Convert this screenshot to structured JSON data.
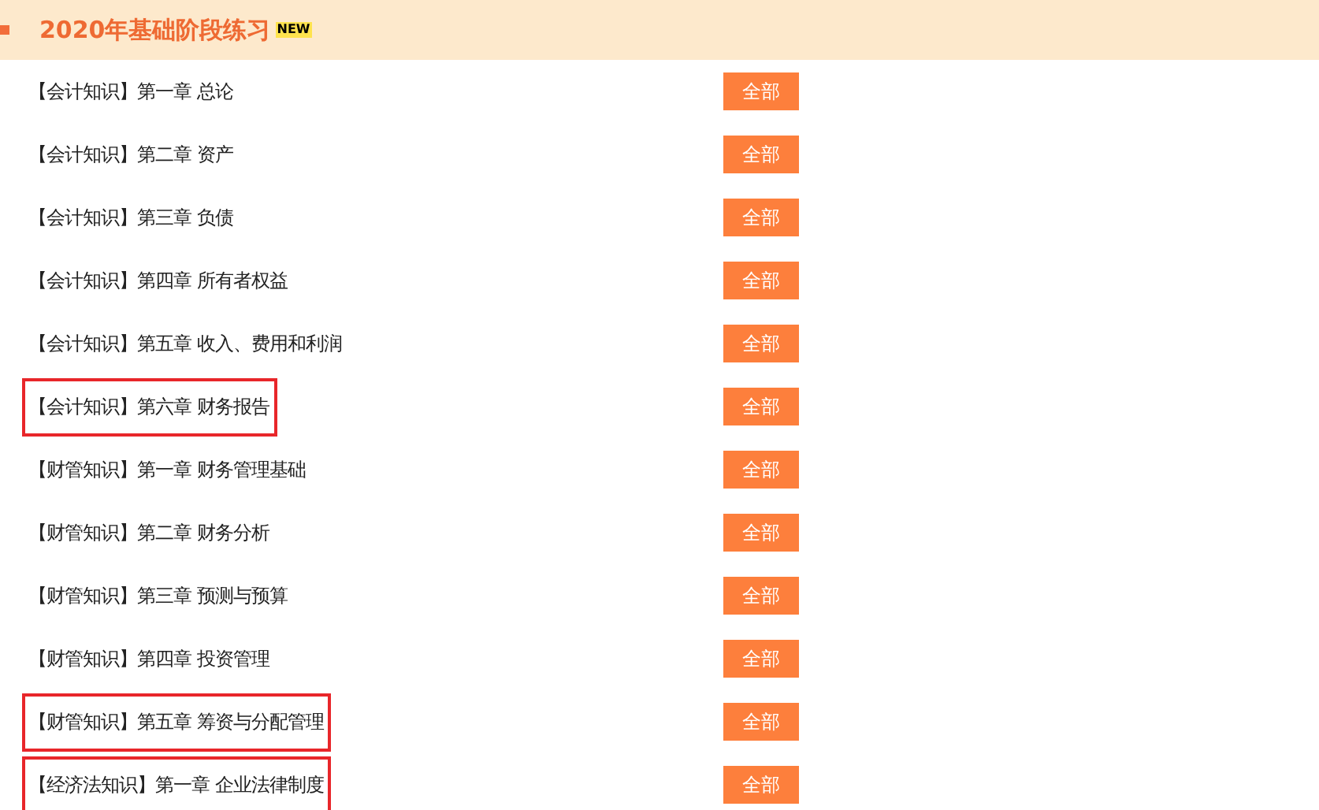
{
  "section": {
    "title": "2020年基础阶段练习",
    "badge": "NEW"
  },
  "rows": [
    {
      "label": "【会计知识】第一章  总论",
      "button": "全部",
      "highlighted": false
    },
    {
      "label": "【会计知识】第二章  资产",
      "button": "全部",
      "highlighted": false
    },
    {
      "label": "【会计知识】第三章  负债",
      "button": "全部",
      "highlighted": false
    },
    {
      "label": "【会计知识】第四章  所有者权益",
      "button": "全部",
      "highlighted": false
    },
    {
      "label": "【会计知识】第五章  收入、费用和利润",
      "button": "全部",
      "highlighted": false
    },
    {
      "label": "【会计知识】第六章  财务报告",
      "button": "全部",
      "highlighted": true
    },
    {
      "label": "【财管知识】第一章  财务管理基础",
      "button": "全部",
      "highlighted": false
    },
    {
      "label": "【财管知识】第二章  财务分析",
      "button": "全部",
      "highlighted": false
    },
    {
      "label": "【财管知识】第三章  预测与预算",
      "button": "全部",
      "highlighted": false
    },
    {
      "label": "【财管知识】第四章  投资管理",
      "button": "全部",
      "highlighted": false
    },
    {
      "label": "【财管知识】第五章  筹资与分配管理",
      "button": "全部",
      "highlighted": true
    },
    {
      "label": "【经济法知识】第一章  企业法律制度",
      "button": "全部",
      "highlighted": true
    }
  ]
}
